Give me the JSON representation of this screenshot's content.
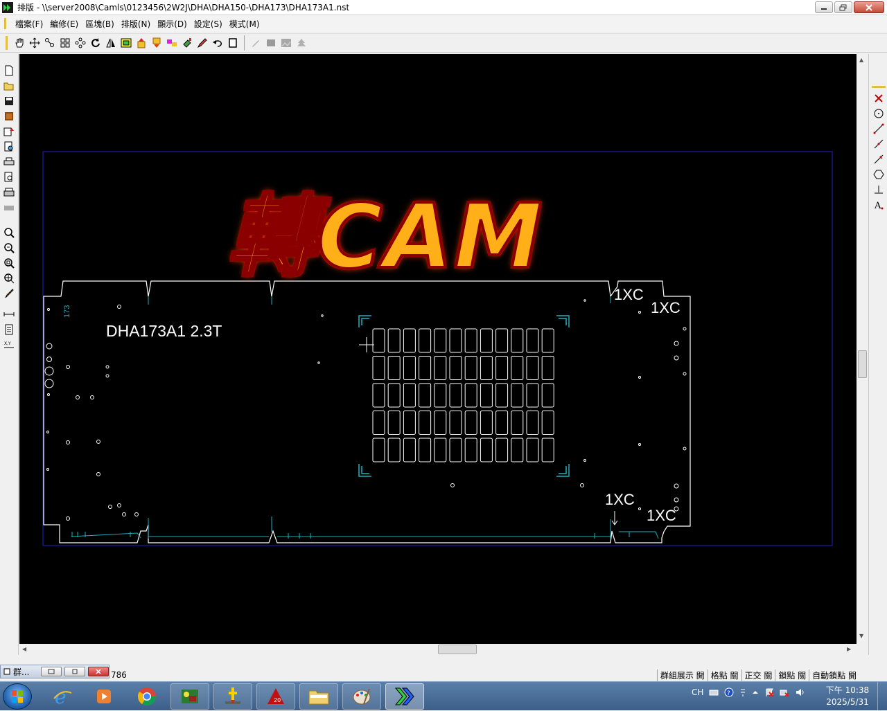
{
  "window": {
    "title": "排版 - \\\\server2008\\Camls\\0123456\\2W2J\\DHA\\DHA150-\\DHA173\\DHA173A1.nst"
  },
  "menu": [
    {
      "label": "檔案(F)"
    },
    {
      "label": "編修(E)"
    },
    {
      "label": "區塊(B)"
    },
    {
      "label": "排版(N)"
    },
    {
      "label": "顯示(D)"
    },
    {
      "label": "設定(S)"
    },
    {
      "label": "模式(M)"
    }
  ],
  "toolbar_icons": [
    "hand-pan-icon",
    "move-arrows-icon",
    "copy-move-icon",
    "grid-array-icon",
    "circular-array-icon",
    "rotate-icon",
    "mirror-icon",
    "layer-icon",
    "bring-up-icon",
    "send-back-icon",
    "swap-icon",
    "paint-icon",
    "pen-edit-icon",
    "undo-icon",
    "rectangle-icon",
    "pencil-disabled-icon",
    "box-disabled-icon",
    "image-disabled-icon",
    "tree-disabled-icon"
  ],
  "left_toolbar_icons": [
    "new-file-icon",
    "open-file-icon",
    "save-icon",
    "save-as-icon",
    "export-icon",
    "preview-icon",
    "print-icon",
    "print-preview-icon",
    "printer-icon",
    "plotter-icon",
    "zoom-in-icon",
    "zoom-fit-icon",
    "zoom-window-icon",
    "zoom-center-icon",
    "brush-icon",
    "measure-icon",
    "list-icon",
    "coordinate-icon"
  ],
  "right_toolbar_icons": [
    "delete-x-icon",
    "circle-icon",
    "line-icon",
    "polyline-icon",
    "line-angle-icon",
    "polygon-icon",
    "perpendicular-icon",
    "text-icon"
  ],
  "canvas": {
    "overlay_text": "轉CAM",
    "part_label": "DHA173A1  2.3T",
    "side_label": "173",
    "marks": [
      "1XC",
      "1XC",
      "1XC",
      "1XC"
    ],
    "colors": {
      "background": "#000000",
      "outline": "#ffffff",
      "accent": "#20b0c0",
      "frame": "#2020c8",
      "overlay": "#ffb018"
    }
  },
  "status": {
    "mini_window_label": "群...",
    "coordinate": "786",
    "toggles": [
      "群組展示 開",
      "格點 關",
      "正交 關",
      "鎖點 關",
      "自動鎖點 開"
    ]
  },
  "taskbar": {
    "apps": [
      "ie-icon",
      "media-player-icon",
      "chrome-icon",
      "cad-app-icon",
      "cnc-app-icon",
      "acrobat-icon",
      "file-explorer-icon",
      "paint-icon",
      "nesting-app-icon"
    ],
    "tray_lang": "CH",
    "clock_time": "下午 10:38",
    "clock_date": "2025/5/31"
  }
}
